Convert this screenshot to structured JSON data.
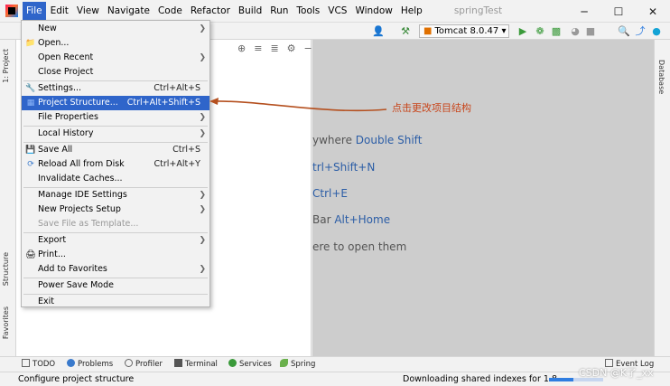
{
  "window": {
    "menus": [
      "File",
      "Edit",
      "View",
      "Navigate",
      "Code",
      "Refactor",
      "Build",
      "Run",
      "Tools",
      "VCS",
      "Window",
      "Help"
    ],
    "project_name": "springTest",
    "minimize": "─",
    "maximize": "☐",
    "close": "✕"
  },
  "toolbar": {
    "run_config": "Tomcat 8.0.47"
  },
  "side_tabs": {
    "project": "1: Project",
    "structure": "Structure",
    "favorites": "Favorites",
    "database": "Database"
  },
  "file_menu": {
    "items": [
      {
        "label": "New",
        "shortcut": "",
        "submenu": true
      },
      {
        "label": "Open...",
        "shortcut": "",
        "submenu": false
      },
      {
        "label": "Open Recent",
        "shortcut": "",
        "submenu": true
      },
      {
        "label": "Close Project",
        "shortcut": "",
        "submenu": false
      },
      {
        "label": "Settings...",
        "shortcut": "Ctrl+Alt+S",
        "submenu": false
      },
      {
        "label": "Project Structure...",
        "shortcut": "Ctrl+Alt+Shift+S",
        "submenu": false,
        "highlighted": true
      },
      {
        "label": "File Properties",
        "shortcut": "",
        "submenu": true
      },
      {
        "label": "Local History",
        "shortcut": "",
        "submenu": true
      },
      {
        "label": "Save All",
        "shortcut": "Ctrl+S",
        "submenu": false
      },
      {
        "label": "Reload All from Disk",
        "shortcut": "Ctrl+Alt+Y",
        "submenu": false
      },
      {
        "label": "Invalidate Caches...",
        "shortcut": "",
        "submenu": false
      },
      {
        "label": "Manage IDE Settings",
        "shortcut": "",
        "submenu": true
      },
      {
        "label": "New Projects Setup",
        "shortcut": "",
        "submenu": true
      },
      {
        "label": "Save File as Template...",
        "shortcut": "",
        "submenu": false,
        "disabled": true
      },
      {
        "label": "Export",
        "shortcut": "",
        "submenu": true
      },
      {
        "label": "Print...",
        "shortcut": "",
        "submenu": false
      },
      {
        "label": "Add to Favorites",
        "shortcut": "",
        "submenu": true
      },
      {
        "label": "Power Save Mode",
        "shortcut": "",
        "submenu": false
      },
      {
        "label": "Exit",
        "shortcut": "",
        "submenu": false
      }
    ]
  },
  "annotation": "点击更改项目结构",
  "editor_hints": [
    {
      "text": "ywhere ",
      "key": "Double Shift"
    },
    {
      "text": "",
      "key": "trl+Shift+N"
    },
    {
      "text": " ",
      "key": "Ctrl+E"
    },
    {
      "text": "Bar ",
      "key": "Alt+Home"
    },
    {
      "text": "ere to open them",
      "key": ""
    }
  ],
  "bottom_tabs": [
    "TODO",
    "Problems",
    "Profiler",
    "Terminal",
    "Services",
    "Spring",
    "Event Log"
  ],
  "status": {
    "left": "Configure project structure",
    "right": "Downloading shared indexes for 1.8",
    "progress": 0.45
  },
  "watermark": "CSDN @K了_xx",
  "colors": {
    "accent": "#2f65ca",
    "annotation": "#c8461c",
    "editor_bg": "#cdcdcd",
    "shortcut_key": "#2b5da6"
  }
}
